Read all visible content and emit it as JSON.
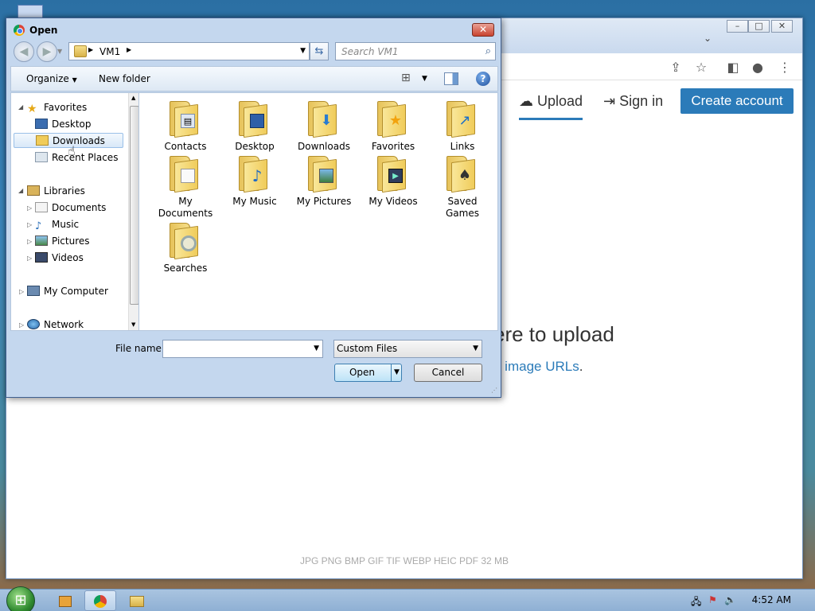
{
  "browser": {
    "nav": {
      "upload_label": "Upload",
      "signin_label": "Sign in",
      "create_account_label": "Create account"
    },
    "drop_area": {
      "title_visible": "ere to upload",
      "subtitle_link": "d image URLs",
      "subtitle_dot": "."
    },
    "formats": "JPG PNG BMP GIF TIF WEBP HEIC PDF   32 MB"
  },
  "dialog": {
    "title": "Open",
    "address": {
      "segments": [
        "VM1"
      ]
    },
    "search_placeholder": "Search VM1",
    "toolbar": {
      "organize_label": "Organize",
      "new_folder_label": "New folder"
    },
    "nav_pane": {
      "favorites_label": "Favorites",
      "desktop_label": "Desktop",
      "downloads_label": "Downloads",
      "recent_label": "Recent Places",
      "libraries_label": "Libraries",
      "documents_label": "Documents",
      "music_label": "Music",
      "pictures_label": "Pictures",
      "videos_label": "Videos",
      "computer_label": "My Computer",
      "network_label": "Network"
    },
    "files": [
      {
        "line1": "Contacts",
        "line2": ""
      },
      {
        "line1": "Desktop",
        "line2": ""
      },
      {
        "line1": "Downloads",
        "line2": ""
      },
      {
        "line1": "Favorites",
        "line2": ""
      },
      {
        "line1": "Links",
        "line2": ""
      },
      {
        "line1": "My",
        "line2": "Documents"
      },
      {
        "line1": "My Music",
        "line2": ""
      },
      {
        "line1": "My Pictures",
        "line2": ""
      },
      {
        "line1": "My Videos",
        "line2": ""
      },
      {
        "line1": "Saved",
        "line2": "Games"
      },
      {
        "line1": "Searches",
        "line2": ""
      }
    ],
    "file_name_label": "File name:",
    "file_name_value": "",
    "file_type_value": "Custom Files",
    "open_label": "Open",
    "cancel_label": "Cancel"
  },
  "taskbar": {
    "clock": "4:52 AM"
  },
  "colors": {
    "accent": "#2b7bb9",
    "dialog_frame": "#c4d7ee"
  }
}
